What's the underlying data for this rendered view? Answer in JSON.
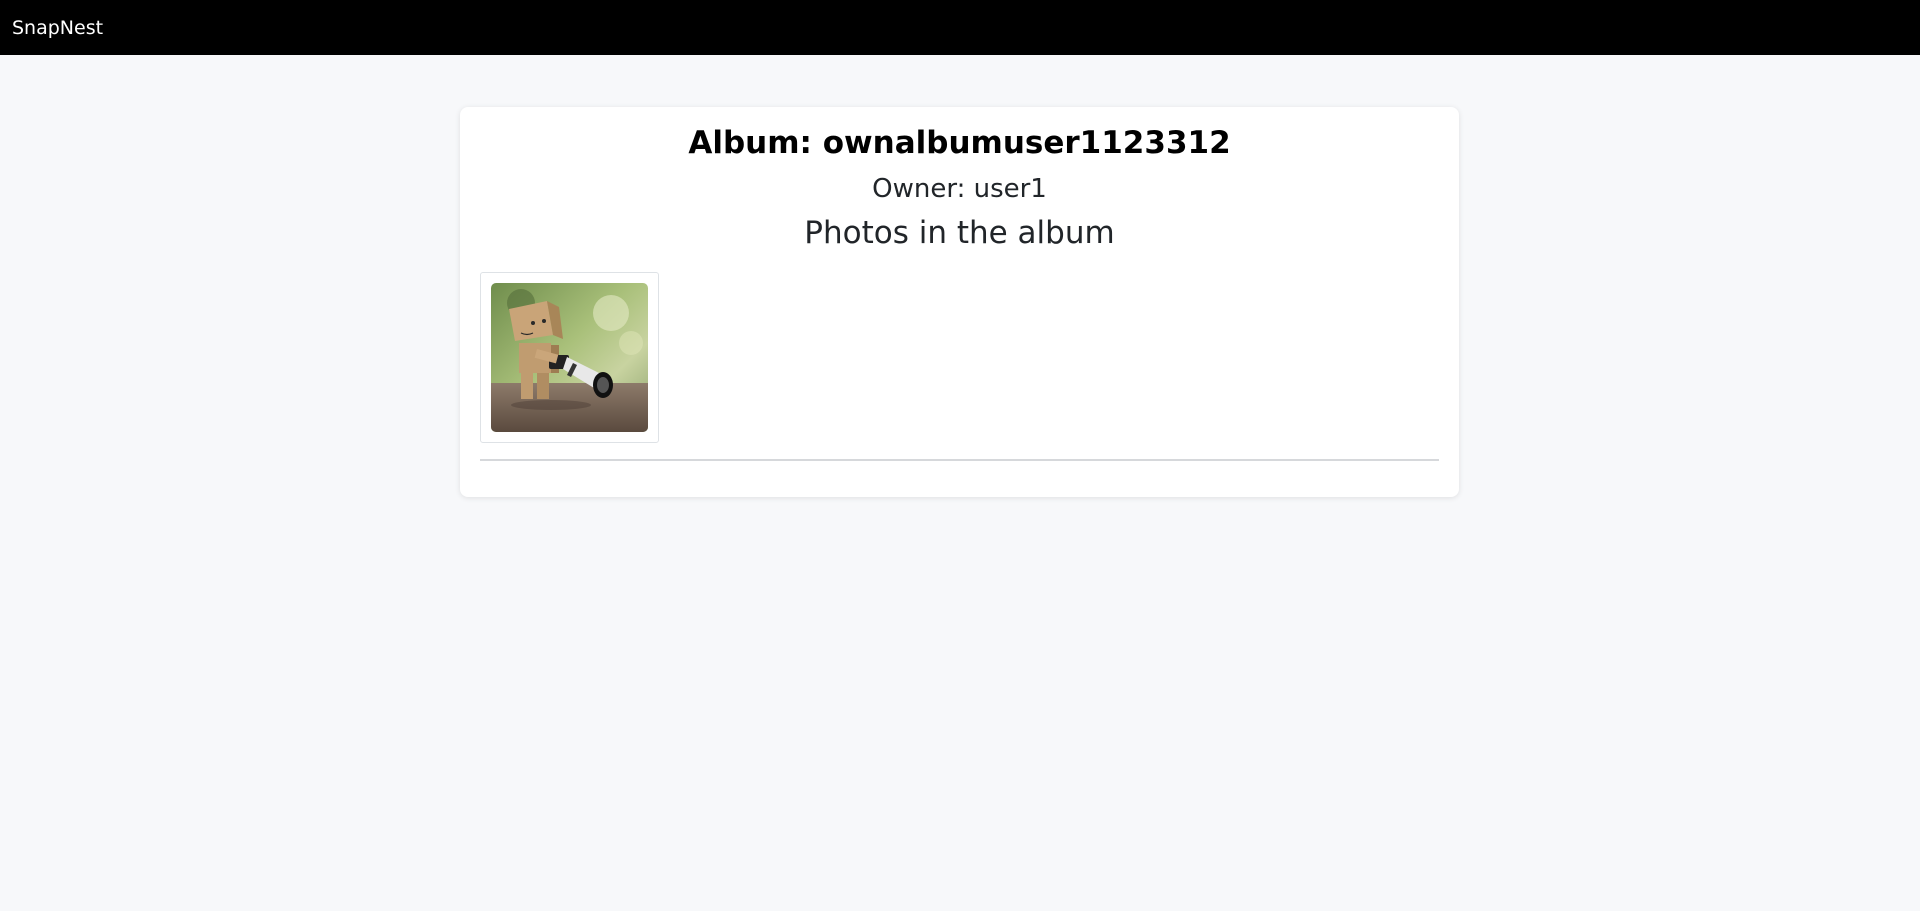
{
  "app": {
    "brand": "SnapNest"
  },
  "album": {
    "title": "Album: ownalbumuser1123312",
    "owner": "Owner: user1",
    "photos_heading": "Photos in the album",
    "photos": [
      {
        "subject": "cardboard-robot-with-camera-photo"
      }
    ]
  },
  "colors": {
    "topbar": "#000000",
    "background": "#f7f8fa",
    "card": "#ffffff"
  }
}
